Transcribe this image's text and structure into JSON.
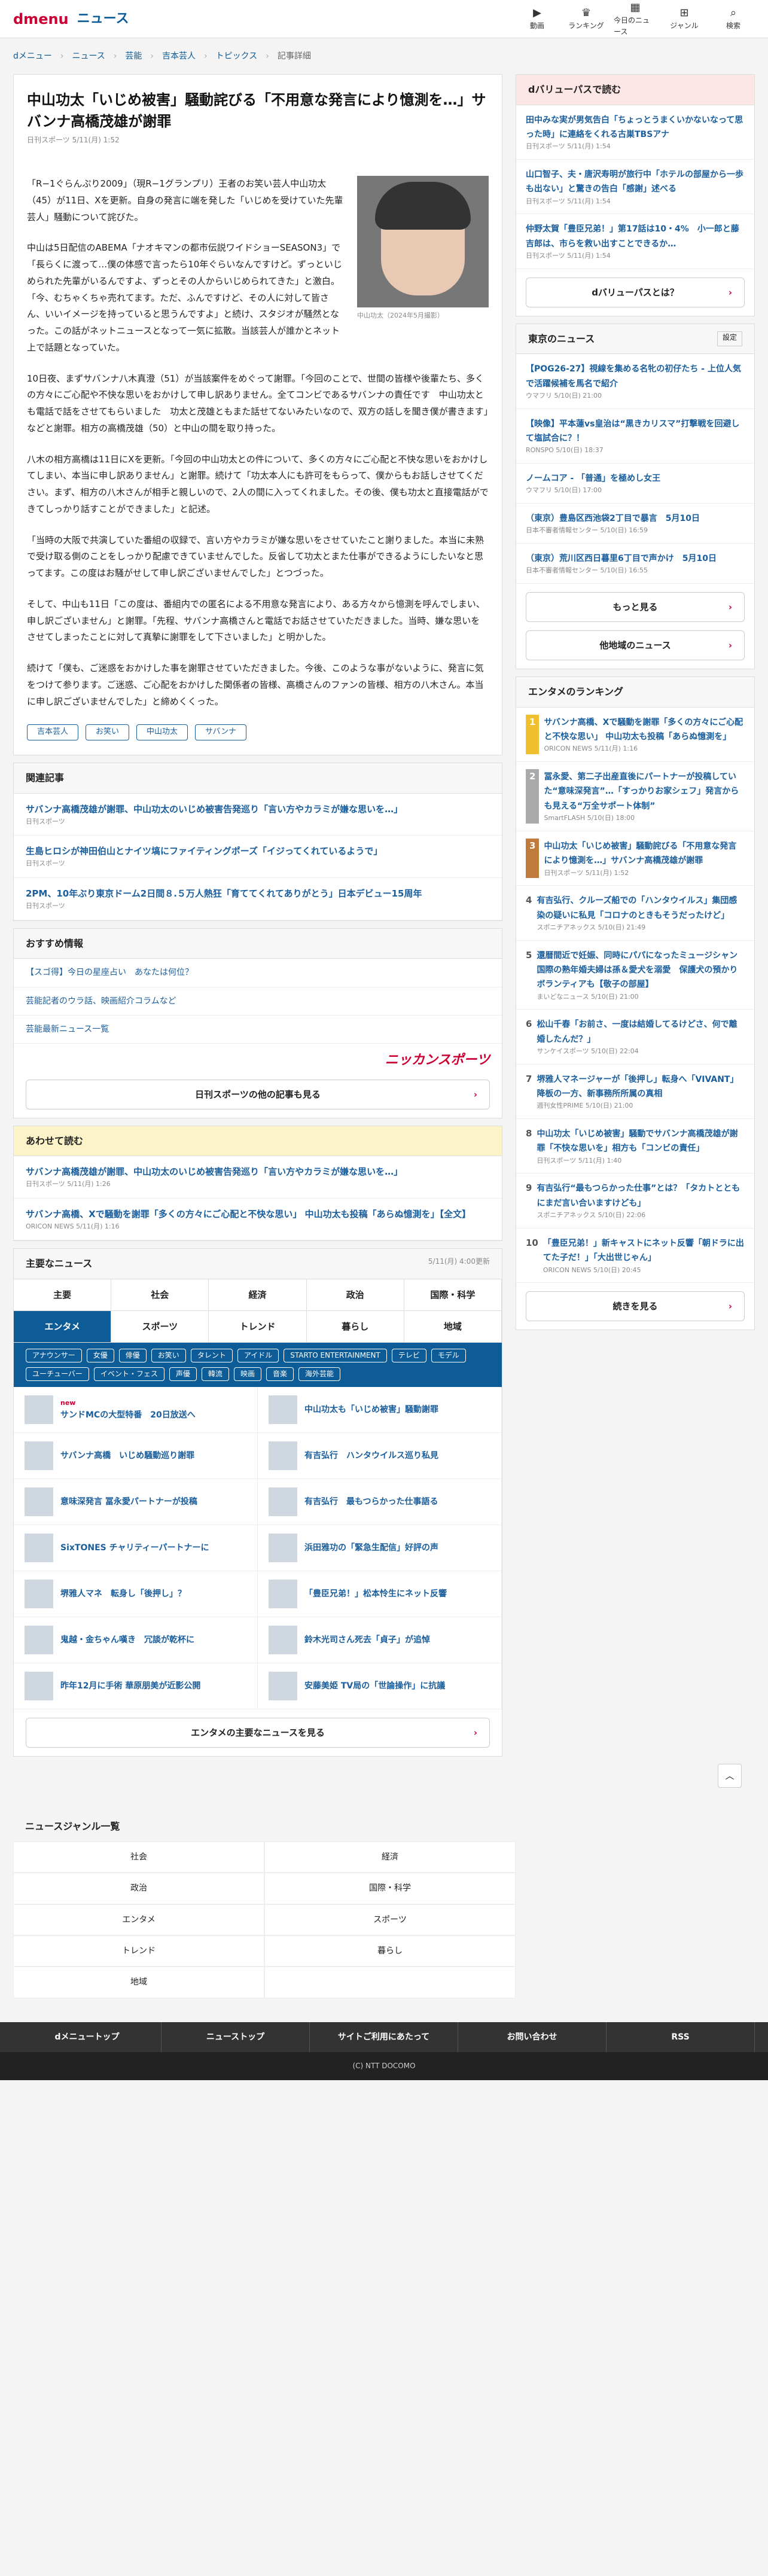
{
  "header": {
    "logo": "dmenu",
    "site": "ニュース",
    "nav": [
      "動画",
      "ランキング",
      "今日のニュース",
      "ジャンル",
      "検索"
    ],
    "nav_icons": [
      "video-icon",
      "crown-icon",
      "calendar-icon",
      "grid-icon",
      "search-icon"
    ]
  },
  "breadcrumb": [
    "dメニュー",
    "ニュース",
    "芸能",
    "吉本芸人",
    "トピックス",
    "記事詳細"
  ],
  "article": {
    "title": "中山功太「いじめ被害」騒動詫びる「不用意な発言により憶測を…」サバンナ高橋茂雄が謝罪",
    "meta": "日刊スポーツ 5/11(月) 1:52",
    "caption": "中山功太（2024年5月撮影）",
    "paragraphs": [
      "「R−1ぐらんぷり2009」（現R−1グランプリ）王者のお笑い芸人中山功太（45）が11日、Xを更新。自身の発言に端を発した「いじめを受けていた先輩芸人」騒動について詫びた。",
      "中山は5日配信のABEMA「ナオキマンの都市伝説ワイドショーSEASON3」で「長らくに渡って…僕の体感で言ったら10年ぐらいなんですけど。ずっといじめられた先輩がいるんですよ、ずっとその人からいじめられてきた」と激白。「今、むちゃくちゃ売れてます。ただ、ふんですけど、その人に対して皆さん、いいイメージを持っていると思うんですよ」と続け、スタジオが騒然となった。この話がネットニュースとなって一気に拡散。当該芸人が誰かとネット上で話題となっていた。",
      "10日夜、まずサバンナ八木真澄（51）が当該案件をめぐって謝罪。「今回のことで、世間の皆様や後輩たち、多くの方々にご心配や不快な思いをおかけして申し訳ありません。全てコンビであるサバンナの責任です　中山功太とも電話で話をさせてもらいました　功太と茂雄ともまた話せてないみたいなので、双方の話しを聞き僕が書きます」などと謝罪。相方の高橋茂雄（50）と中山の間を取り持った。",
      "八木の相方高橋は11日にXを更新。「今回の中山功太との件について、多くの方々にご心配と不快な思いをおかけしてしまい、本当に申し訳ありません」と謝罪。続けて「功太本人にも許可をもらって、僕からもお話しさせてください。まず、相方の八木さんが相手と親しいので、2人の間に入ってくれました。その後、僕も功太と直接電話ができてしっかり話すことができました」と記述。",
      "「当時の大阪で共演していた番組の収録で、言い方やカラミが嫌な思いをさせていたこと謝りました。本当に未熟で受け取る側のことをしっかり配慮できていませんでした。反省して功太とまた仕事ができるようにしたいなと思ってます。この度はお騒がせして申し訳ございませんでした」とつづった。",
      "そして、中山も11日「この度は、番組内での匿名による不用意な発言により、ある方々から憶測を呼んでしまい、申し訳ございません」と謝罪。「先程、サバンナ高橋さんと電話でお話させていただきました。当時、嫌な思いをさせてしまったことに対して真摯に謝罪をして下さいました」と明かした。",
      "続けて「僕も、ご迷惑をおかけした事を謝罪させていただきました。今後、このような事がないように、発言に気をつけて参ります。ご迷惑、ご心配をおかけした関係者の皆様、高橋さんのファンの皆様、相方の八木さん。本当に申し訳ございませんでした」と締めくくった。"
    ],
    "tags": [
      "吉本芸人",
      "お笑い",
      "中山功太",
      "サバンナ"
    ]
  },
  "related": {
    "heading": "関連記事",
    "items": [
      {
        "title": "サバンナ高橋茂雄が謝罪、中山功太のいじめ被害告発巡り「言い方やカラミが嫌な思いを…」",
        "src": "日刊スポーツ"
      },
      {
        "title": "生島ヒロシが神田伯山とナイツ塙にファイティングポーズ「イジってくれているようで」",
        "src": "日刊スポーツ"
      },
      {
        "title": "2PM、10年ぶり東京ドーム2日間８.５万人熱狂「育ててくれてありがとう」日本デビュー15周年",
        "src": "日刊スポーツ"
      }
    ]
  },
  "recommend": {
    "heading": "おすすめ情報",
    "items": [
      "【スゴ得】今日の星座占い　あなたは何位？",
      "芸能記者のウラ話、映画紹介コラムなど",
      "芸能最新ニュース一覧"
    ],
    "logo": "ニッカンスポーツ",
    "more": "日刊スポーツの他の記事も見る"
  },
  "also": {
    "heading": "あわせて読む",
    "items": [
      {
        "title": "サバンナ高橋茂雄が謝罪、中山功太のいじめ被害告発巡り「言い方やカラミが嫌な思いを…」",
        "src": "日刊スポーツ 5/11(月) 1:26"
      },
      {
        "title": "サバンナ高橋、Xで騒動を謝罪「多くの方々にご心配と不快な思い」 中山功太も投稿「あらぬ憶測を」【全文】",
        "src": "ORICON NEWS 5/11(月) 1:16"
      }
    ]
  },
  "major": {
    "heading": "主要なニュース",
    "date": "5/11(月) 4:00更新",
    "cats": [
      "主要",
      "社会",
      "経済",
      "政治",
      "国際・科学",
      "エンタメ",
      "スポーツ",
      "トレンド",
      "暮らし",
      "地域"
    ],
    "chips": [
      "アナウンサー",
      "女優",
      "俳優",
      "お笑い",
      "タレント",
      "アイドル",
      "STARTO ENTERTAINMENT",
      "テレビ",
      "モデル",
      "ユーチューバー",
      "イベント・フェス",
      "声優",
      "韓流",
      "映画",
      "音楽",
      "海外芸能"
    ],
    "items": [
      "サンドMCの大型特番　20日放送へ",
      "中山功太も「いじめ被害」騒動謝罪",
      "サバンナ高橋　いじめ騒動巡り謝罪",
      "有吉弘行　ハンタウイルス巡り私見",
      "意味深発言 冨永愛パートナーが投稿",
      "有吉弘行　最もつらかった仕事語る",
      "SixTONES チャリティーパートナーに",
      "浜田雅功の「緊急生配信」好評の声",
      "堺雅人マネ　転身し「後押し」？",
      "「豊臣兄弟！」松本怜生にネット反響",
      "鬼越・金ちゃん嘆き　冗談が乾杯に",
      "鈴木光司さん死去「貞子」が追悼",
      "昨年12月に手術 華原朋美が近影公開",
      "安藤美姫 TV局の「世論操作」に抗議"
    ],
    "new": "new",
    "more": "エンタメの主要なニュースを見る"
  },
  "genre": {
    "heading": "ニュースジャンル一覧",
    "items": [
      "社会",
      "経済",
      "政治",
      "国際・科学",
      "エンタメ",
      "スポーツ",
      "トレンド",
      "暮らし",
      "地域"
    ]
  },
  "footer": {
    "nav": [
      "dメニュートップ",
      "ニューストップ",
      "サイトご利用にあたって",
      "お問い合わせ",
      "RSS"
    ],
    "copy": "(C) NTT DOCOMO"
  },
  "side": {
    "dvalue": {
      "heading": "dバリューパスで読む",
      "items": [
        {
          "title": "田中みな実が男気告白「ちょっとうまくいかないなって思った時」に連絡をくれる古巣TBSアナ",
          "src": "日刊スポーツ 5/11(月) 1:54"
        },
        {
          "title": "山口智子、夫・唐沢寿明が旅行中「ホテルの部屋から一歩も出ない」と驚きの告白「感謝」述べる",
          "src": "日刊スポーツ 5/11(月) 1:54"
        },
        {
          "title": "仲野太賀「豊臣兄弟！」第17話は10・4%　小一郎と藤吉郎は、市らを救い出すことできるか…",
          "src": "日刊スポーツ 5/11(月) 1:54"
        }
      ],
      "btn": "dバリューパスとは？"
    },
    "tokyo": {
      "heading": "東京のニュース",
      "setting": "設定",
      "items": [
        {
          "title": "【POG26-27】視線を集める名牝の初仔たち - 上位人気で活躍候補を馬名で紹介",
          "src": "ウマフリ 5/10(日) 21:00"
        },
        {
          "title": "【映像】平本蓮vs皇治は“黒きカリスマ”打撃戦を回避して塩試合に？！",
          "src": "RONSPO 5/10(日) 18:37"
        },
        {
          "title": "ノームコア - 「普通」を極めし女王",
          "src": "ウマフリ 5/10(日) 17:00"
        },
        {
          "title": "（東京）豊島区西池袋2丁目で暴言　5月10日",
          "src": "日本不審者情報センター 5/10(日) 16:59"
        },
        {
          "title": "（東京）荒川区西日暮里6丁目で声かけ　5月10日",
          "src": "日本不審者情報センター 5/10(日) 16:55"
        }
      ],
      "more": "もっと見る",
      "other": "他地域のニュース"
    },
    "ranking": {
      "heading": "エンタメのランキング",
      "items": [
        {
          "title": "サバンナ高橋、Xで騒動を謝罪「多くの方々にご心配と不快な思い」 中山功太も投稿「あらぬ憶測を」",
          "src": "ORICON NEWS 5/11(月) 1:16"
        },
        {
          "title": "冨永愛、第二子出産直後にパートナーが投稿していた“意味深発言”…「すっかりお家シェフ」発言からも見える“万全サポート体制”",
          "src": "SmartFLASH 5/10(日) 18:00"
        },
        {
          "title": "中山功太「いじめ被害」騒動詫びる「不用意な発言により憶測を…」サバンナ高橋茂雄が謝罪",
          "src": "日刊スポーツ 5/11(月) 1:52"
        },
        {
          "title": "有吉弘行、クルーズ船での「ハンタウイルス」集団感染の疑いに私見「コロナのときもそうだったけど」",
          "src": "スポニチアネックス 5/10(日) 21:49"
        },
        {
          "title": "還暦間近で妊娠、同時にパパになったミュージシャン　国際の熟年婚夫婦は孫＆愛犬を溺愛　保護犬の預かりボランティアも【敬子の部屋】",
          "src": "まいどなニュース 5/10(日) 21:00"
        },
        {
          "title": "松山千春「お前さ、一度は結婚してるけどさ、何で離婚したんだ？」",
          "src": "サンケイスポーツ 5/10(日) 22:04"
        },
        {
          "title": "堺雅人マネージャーが「後押し」転身へ「VIVANT」降板の一方、新事務所所属の真相",
          "src": "週刊女性PRIME 5/10(日) 21:00"
        },
        {
          "title": "中山功太「いじめ被害」騒動でサバンナ高橋茂雄が謝罪「不快な思いを」相方も「コンビの責任」",
          "src": "日刊スポーツ 5/11(月) 1:40"
        },
        {
          "title": "有吉弘行“最もつらかった仕事”とは？「タカトとともにまだ言い合いますけども」",
          "src": "スポニチアネックス 5/10(日) 22:06"
        },
        {
          "title": "「豊臣兄弟！」新キャストにネット反響「朝ドラに出てた子だ！」「大出世じゃん」",
          "src": "ORICON NEWS 5/10(日) 20:45"
        }
      ],
      "more": "続きを見る"
    }
  }
}
